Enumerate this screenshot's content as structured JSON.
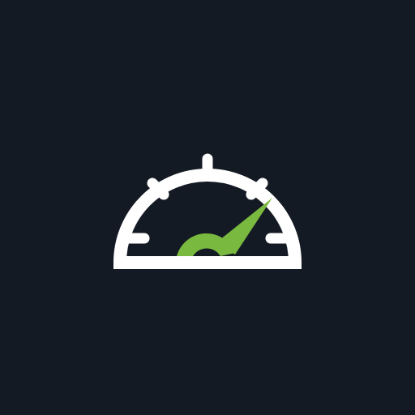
{
  "icon": {
    "name": "speedometer-icon"
  },
  "colors": {
    "background": "#141a24",
    "outline": "#ffffff",
    "needle": "#7ab940"
  }
}
